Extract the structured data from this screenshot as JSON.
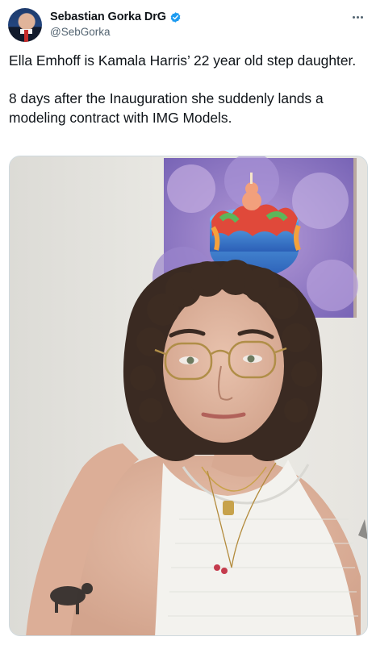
{
  "author": {
    "display_name": "Sebastian Gorka DrG",
    "handle": "@SebGorka",
    "verified_icon": "verified-badge-icon",
    "avatar": "avatar"
  },
  "tweet": {
    "text": "Ella Emhoff is Kamala Harris’ 22 year old step daughter.\n\n8 days after the Inauguration she suddenly lands a modeling contract with IMG Models."
  },
  "media": {
    "type": "photo",
    "description_icon": "photo-of-woman-with-glasses"
  },
  "colors": {
    "text": "#0f1419",
    "secondary": "#536471",
    "verified": "#1d9bf0",
    "border": "#cfd9de"
  }
}
